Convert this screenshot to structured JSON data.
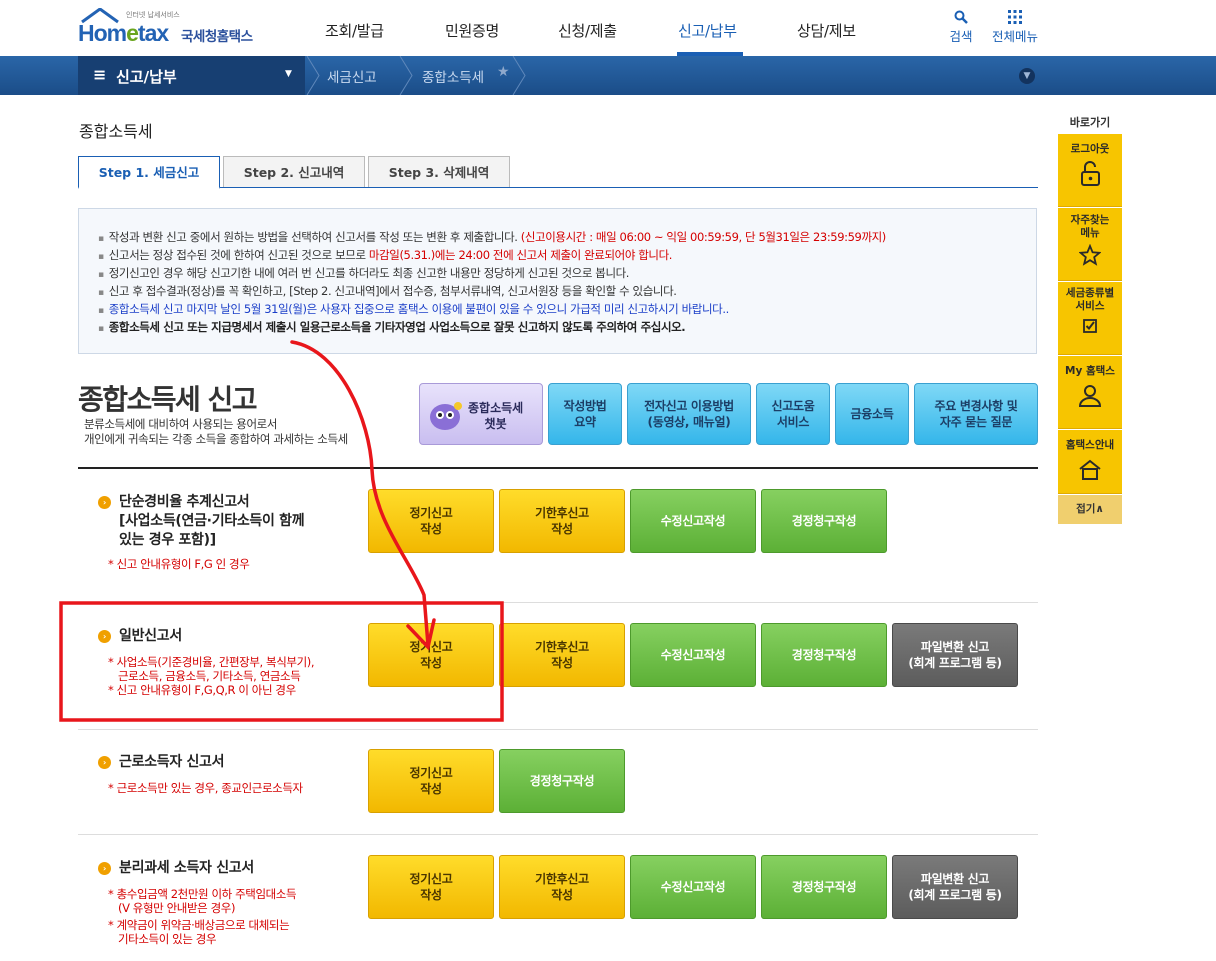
{
  "header": {
    "logo_small": "인터넷 납세서비스",
    "logo_brand_a": "Hom",
    "logo_brand_b": "e",
    "logo_brand_c": "tax",
    "logo_kor": "국세청홈택스",
    "nav": [
      "조회/발급",
      "민원증명",
      "신청/제출",
      "신고/납부",
      "상담/제보"
    ],
    "active_nav_index": 3,
    "search_label": "검색",
    "all_menu_label": "전체메뉴"
  },
  "subbar": {
    "menu_label": "신고/납부",
    "crumb1": "세금신고",
    "crumb2": "종합소득세"
  },
  "page_title": "종합소득세",
  "tabs": [
    "Step 1. 세금신고",
    "Step 2. 신고내역",
    "Step 3. 삭제내역"
  ],
  "notice": {
    "l1_a": "작성과 변환 신고 중에서 원하는 방법을 선택하여 신고서를 작성 또는 변환 후 제출합니다.",
    "l1_b": "(신고이용시간 : 매일 06:00 ~ 익일 00:59:59, 단 5월31일은 23:59:59까지)",
    "l2_a": "신고서는 정상 접수된 것에 한하여 신고된 것으로 보므로",
    "l2_b": "마감일(5.31.)에는 24:00 전에 신고서 제출이 완료되어야 합니다.",
    "l3": "정기신고인 경우 해당 신고기한 내에 여러 번 신고를 하더라도 최종 신고한 내용만 정당하게 신고된 것으로 봅니다.",
    "l4": "신고 후 접수결과(정상)를 꼭 확인하고, [Step 2. 신고내역]에서 접수증, 첨부서류내역, 신고서원장 등을 확인할 수 있습니다.",
    "l5": "종합소득세 신고 마지막 날인 5월 31일(월)은 사용자 집중으로 홈택스 이용에 불편이 있을 수 있으니 가급적 미리 신고하시기 바랍니다..",
    "l6": "종합소득세 신고 또는 지급명세서 제출시 일용근로소득을 기타자영업 사업소득으로 잘못 신고하지 않도록 주의하여 주십시오."
  },
  "main": {
    "title": "종합소득세 신고",
    "desc1": "분류소득세에 대비하여 사용되는 용어로서",
    "desc2": "개인에게 귀속되는 각종 소득을 종합하여 과세하는 소득세",
    "chatbot_l1": "종합소득세",
    "chatbot_l2": "챗봇",
    "quick_buttons": [
      {
        "l1": "작성방법",
        "l2": "요약"
      },
      {
        "l1": "전자신고 이용방법",
        "l2": "(동영상, 매뉴얼)"
      },
      {
        "l1": "신고도움",
        "l2": "서비스"
      },
      {
        "l1": "금융소득",
        "l2": ""
      },
      {
        "l1": "주요 변경사항 및",
        "l2": "자주 묻는 질문"
      }
    ]
  },
  "sections": [
    {
      "title_l1": "단순경비율 추계신고서",
      "title_l2": "[사업소득(연금·기타소득이 함께",
      "title_l3": "있는 경우 포함)]",
      "note1": "* 신고 안내유형이 F,G 인 경우",
      "buttons": [
        {
          "l1": "정기신고",
          "l2": "작성"
        },
        {
          "l1": "기한후신고",
          "l2": "작성"
        },
        {
          "l1": "수정신고작성",
          "l2": ""
        },
        {
          "l1": "경정청구작성",
          "l2": ""
        }
      ]
    },
    {
      "title_l1": "일반신고서",
      "note1": "* 사업소득(기준경비율, 간편장부, 복식부기),",
      "note2": "근로소득, 금융소득, 기타소득, 연금소득",
      "note3": "* 신고 안내유형이 F,G,Q,R 이 아닌 경우",
      "buttons": [
        {
          "l1": "정기신고",
          "l2": "작성"
        },
        {
          "l1": "기한후신고",
          "l2": "작성"
        },
        {
          "l1": "수정신고작성",
          "l2": ""
        },
        {
          "l1": "경정청구작성",
          "l2": ""
        },
        {
          "l1": "파일변환 신고",
          "l2": "(회계 프로그램 등)"
        }
      ]
    },
    {
      "title_l1": "근로소득자 신고서",
      "note1": "* 근로소득만 있는 경우, 종교인근로소득자",
      "buttons": [
        {
          "l1": "정기신고",
          "l2": "작성"
        },
        {
          "l1": "경정청구작성",
          "l2": ""
        }
      ]
    },
    {
      "title_l1": "분리과세 소득자 신고서",
      "note1": "* 총수입금액 2천만원 이하 주택임대소득",
      "note2": "(V 유형만 안내받은 경우)",
      "note3": "* 계약금이 위약금·배상금으로 대체되는",
      "note4": "기타소득이 있는 경우",
      "buttons": [
        {
          "l1": "정기신고",
          "l2": "작성"
        },
        {
          "l1": "기한후신고",
          "l2": "작성"
        },
        {
          "l1": "수정신고작성",
          "l2": ""
        },
        {
          "l1": "경정청구작성",
          "l2": ""
        },
        {
          "l1": "파일변환 신고",
          "l2": "(회계 프로그램 등)"
        }
      ]
    }
  ],
  "quick_menu": {
    "head": "바로가기",
    "items": [
      {
        "l1": "로그아웃",
        "l2": ""
      },
      {
        "l1": "자주찾는",
        "l2": "메뉴"
      },
      {
        "l1": "세금종류별",
        "l2": "서비스"
      },
      {
        "l1": "My 홈택스",
        "l2": ""
      },
      {
        "l1": "홈택스안내",
        "l2": ""
      }
    ],
    "fold": "접기∧"
  },
  "colors": {
    "brand_blue": "#1a5fb4",
    "nav_bar": "#1f5595",
    "yellow_button": "#f2b800",
    "green_button": "#5cb036",
    "gray_button": "#5c5c5c",
    "notice_red": "#d40000",
    "annotation_red": "#e8161b"
  }
}
